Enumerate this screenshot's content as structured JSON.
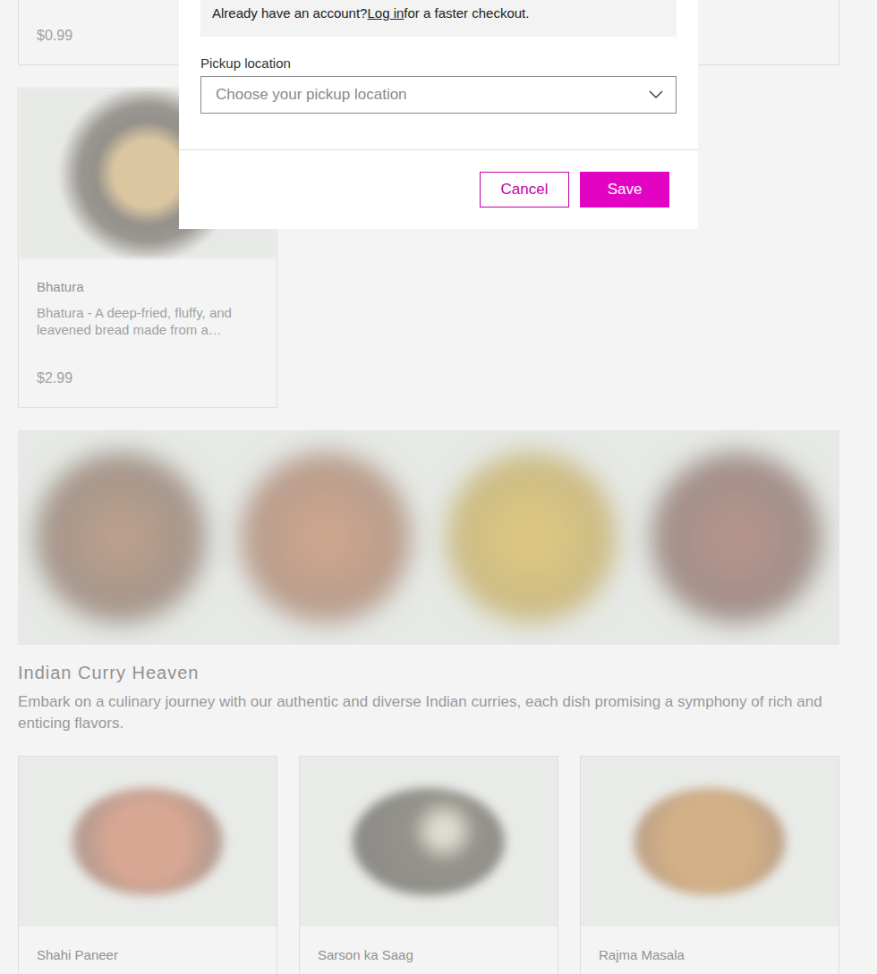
{
  "dialog": {
    "login_prompt": "Already have an account?",
    "login_link": "Log in",
    "login_suffix": "for a faster checkout.",
    "pickup_label": "Pickup location",
    "pickup_placeholder": "Choose your pickup location",
    "buttons": [
      {
        "label": "Cancel",
        "kind": "secondary"
      },
      {
        "label": "Save",
        "kind": "primary"
      }
    ]
  },
  "top_row": [
    {
      "price": "$0.99"
    },
    {
      "price": ""
    },
    {
      "price": ""
    }
  ],
  "breads": [
    {
      "name": "Bhatura",
      "description": "Bhatura - A deep-fried, fluffy, and leavened bread made from a…",
      "price": "$2.99"
    }
  ],
  "section": {
    "title": "Indian Curry Heaven",
    "description": "Embark on a culinary journey with our authentic and diverse Indian curries, each dish promising a symphony of rich and enticing flavors."
  },
  "curries": [
    {
      "name": "Shahi Paneer"
    },
    {
      "name": "Sarson ka Saag"
    },
    {
      "name": "Rajma Masala"
    }
  ]
}
